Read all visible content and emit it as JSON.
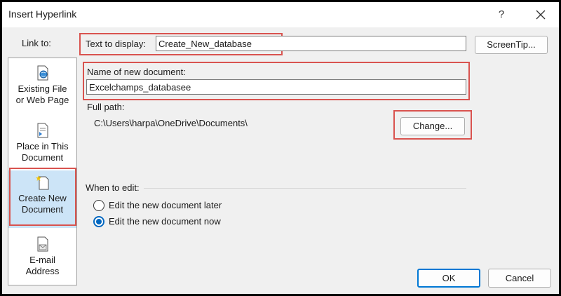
{
  "window": {
    "title": "Insert Hyperlink",
    "help": "?"
  },
  "sidebar": {
    "label": "Link to:",
    "items": [
      {
        "line1": "Existing File",
        "line2": "or Web Page",
        "icon": "web-page-icon"
      },
      {
        "line1": "Place in This",
        "line2": "Document",
        "icon": "document-place-icon"
      },
      {
        "line1": "Create New",
        "line2": "Document",
        "icon": "new-document-icon",
        "selected": true
      },
      {
        "line1": "E-mail",
        "line2": "Address",
        "icon": "email-icon"
      }
    ]
  },
  "form": {
    "text_to_display_label": "Text to display:",
    "text_to_display_value": "Create_New_database",
    "screentip_label": "ScreenTip...",
    "name_label": "Name of new document:",
    "name_value": "Excelchamps_databasee",
    "full_path_label": "Full path:",
    "full_path_value": "C:\\Users\\harpa\\OneDrive\\Documents\\",
    "change_label": "Change...",
    "when_to_edit_label": "When to edit:",
    "radio_later": "Edit the new document later",
    "radio_now": "Edit the new document now"
  },
  "buttons": {
    "ok": "OK",
    "cancel": "Cancel"
  },
  "colors": {
    "highlight": "#d9534f",
    "selected_nav": "#cce4f7",
    "accent": "#0078d4"
  }
}
